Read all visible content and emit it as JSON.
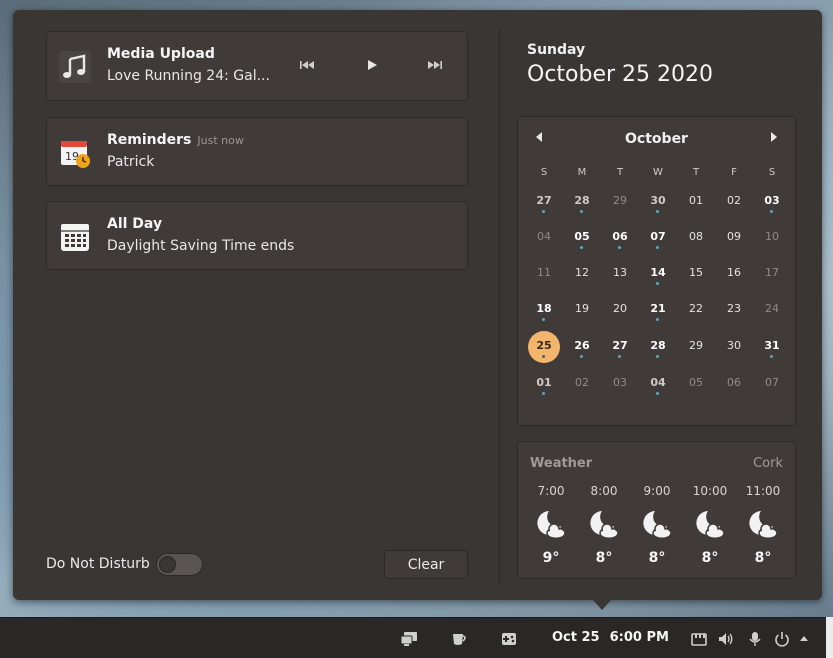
{
  "notifications": [
    {
      "title": "Media Upload",
      "subtitle": "Love Running 24:  Gal...",
      "time": ""
    },
    {
      "title": "Reminders",
      "subtitle": "Patrick",
      "time": "Just now"
    },
    {
      "title": "All Day",
      "subtitle": "Daylight Saving Time ends",
      "time": ""
    }
  ],
  "media": {
    "prev_icon": "skip-back-icon",
    "play_icon": "play-icon",
    "next_icon": "skip-forward-icon"
  },
  "footer": {
    "dnd_label": "Do Not Disturb",
    "dnd_on": false,
    "clear_label": "Clear"
  },
  "date": {
    "day_name": "Sunday",
    "full_date": "October 25 2020"
  },
  "calendar": {
    "month": "October",
    "weekdays": [
      "S",
      "M",
      "T",
      "W",
      "T",
      "F",
      "S"
    ],
    "weeks": [
      [
        {
          "d": "27",
          "o": 1,
          "b": 1,
          "e": 1
        },
        {
          "d": "28",
          "o": 1,
          "b": 1,
          "e": 1
        },
        {
          "d": "29",
          "o": 1
        },
        {
          "d": "30",
          "o": 1,
          "b": 1,
          "e": 1
        },
        {
          "d": "01"
        },
        {
          "d": "02"
        },
        {
          "d": "03",
          "b": 1,
          "e": 1
        }
      ],
      [
        {
          "d": "04",
          "o": 1
        },
        {
          "d": "05",
          "b": 1,
          "e": 1
        },
        {
          "d": "06",
          "b": 1,
          "e": 1
        },
        {
          "d": "07",
          "b": 1,
          "e": 1
        },
        {
          "d": "08"
        },
        {
          "d": "09"
        },
        {
          "d": "10",
          "o": 1
        }
      ],
      [
        {
          "d": "11",
          "o": 1
        },
        {
          "d": "12"
        },
        {
          "d": "13"
        },
        {
          "d": "14",
          "b": 1,
          "e": 1
        },
        {
          "d": "15"
        },
        {
          "d": "16"
        },
        {
          "d": "17",
          "o": 1
        }
      ],
      [
        {
          "d": "18",
          "b": 1,
          "e": 1
        },
        {
          "d": "19"
        },
        {
          "d": "20"
        },
        {
          "d": "21",
          "b": 1,
          "e": 1
        },
        {
          "d": "22"
        },
        {
          "d": "23"
        },
        {
          "d": "24",
          "o": 1
        }
      ],
      [
        {
          "d": "25",
          "t": 1,
          "e": 1
        },
        {
          "d": "26",
          "b": 1,
          "e": 1
        },
        {
          "d": "27",
          "b": 1,
          "e": 1
        },
        {
          "d": "28",
          "b": 1,
          "e": 1
        },
        {
          "d": "29"
        },
        {
          "d": "30"
        },
        {
          "d": "31",
          "b": 1,
          "e": 1
        }
      ],
      [
        {
          "d": "01",
          "o": 1,
          "b": 1,
          "e": 1
        },
        {
          "d": "02",
          "o": 1
        },
        {
          "d": "03",
          "o": 1
        },
        {
          "d": "04",
          "o": 1,
          "b": 1,
          "e": 1
        },
        {
          "d": "05",
          "o": 1
        },
        {
          "d": "06",
          "o": 1
        },
        {
          "d": "07",
          "o": 1
        }
      ]
    ]
  },
  "weather": {
    "title": "Weather",
    "location": "Cork",
    "hours": [
      {
        "time": "7:00",
        "temp": "9°",
        "icon": "moon-cloud-icon"
      },
      {
        "time": "8:00",
        "temp": "8°",
        "icon": "moon-cloud-icon"
      },
      {
        "time": "9:00",
        "temp": "8°",
        "icon": "moon-cloud-icon"
      },
      {
        "time": "10:00",
        "temp": "8°",
        "icon": "moon-cloud-icon"
      },
      {
        "time": "11:00",
        "temp": "8°",
        "icon": "moon-cloud-icon"
      }
    ]
  },
  "taskbar": {
    "date": "Oct 25",
    "time": "6:00 PM",
    "icons": [
      "displays-icon",
      "coffee-cup-icon",
      "gamepad-icon",
      "keyboard-icon",
      "volume-icon",
      "microphone-icon",
      "power-icon",
      "arrow-up-icon"
    ]
  },
  "colors": {
    "panel": "#3a3634",
    "card": "#403b39",
    "accent_today": "#f3b46c",
    "event_dot": "#58a8c0"
  }
}
